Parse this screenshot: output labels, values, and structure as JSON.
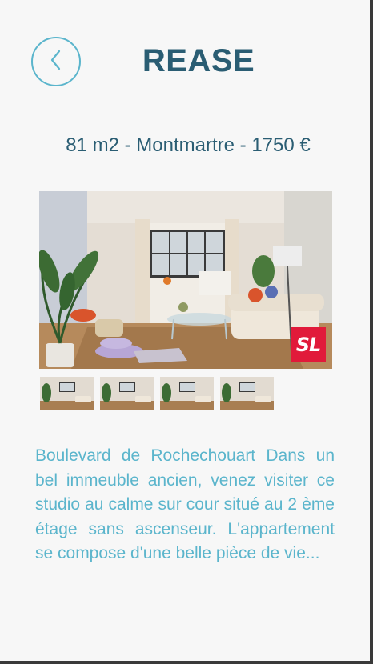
{
  "header": {
    "back_icon": "chevron-left-icon",
    "title": "REASE"
  },
  "listing": {
    "summary": "81 m2 - Montmartre - 1750 €",
    "badge_logo": "SL",
    "thumbnail_count": 4,
    "description": "Boulevard de Rochechouart Dans un bel immeuble ancien, venez visiter ce studio au calme sur cour situé au 2 ème étage sans ascenseur. L'appartement se compose d'une belle pièce de vie..."
  },
  "colors": {
    "accent": "#5bb5cc",
    "title": "#2a5d73",
    "logo": "#e11a3a"
  }
}
